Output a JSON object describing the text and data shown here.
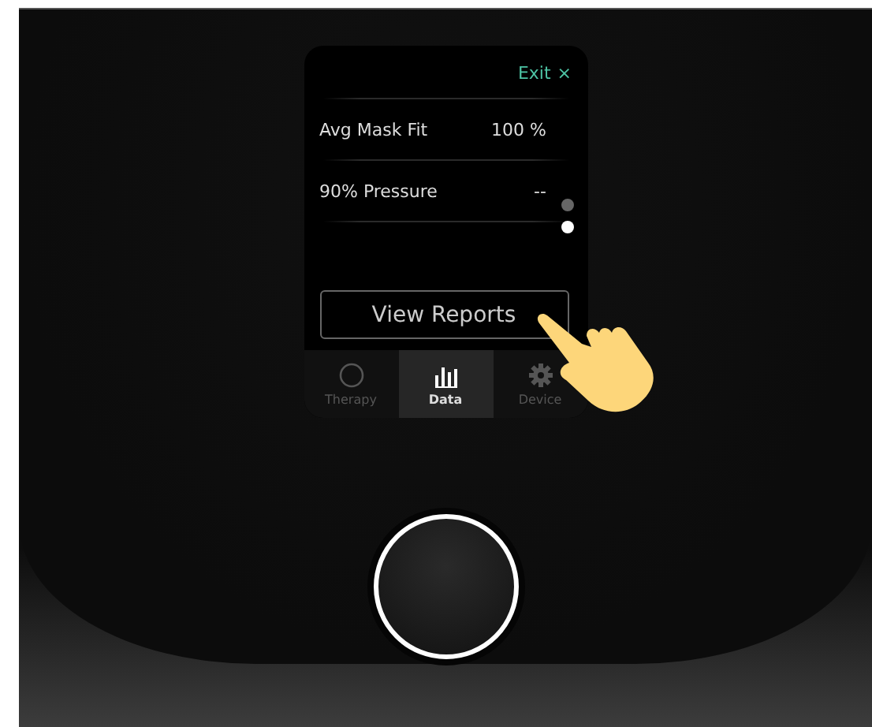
{
  "screen": {
    "exit": {
      "label": "Exit",
      "icon": "×"
    },
    "rows": [
      {
        "label": "Avg Mask Fit",
        "value": "100 %"
      },
      {
        "label": "90% Pressure",
        "value": "--"
      }
    ],
    "page_dots": [
      {
        "selected": false
      },
      {
        "selected": true
      }
    ],
    "button": "View Reports",
    "tabs": [
      {
        "label": "Therapy",
        "selected": false
      },
      {
        "label": "Data",
        "selected": true
      },
      {
        "label": "Device",
        "selected": false
      }
    ]
  }
}
